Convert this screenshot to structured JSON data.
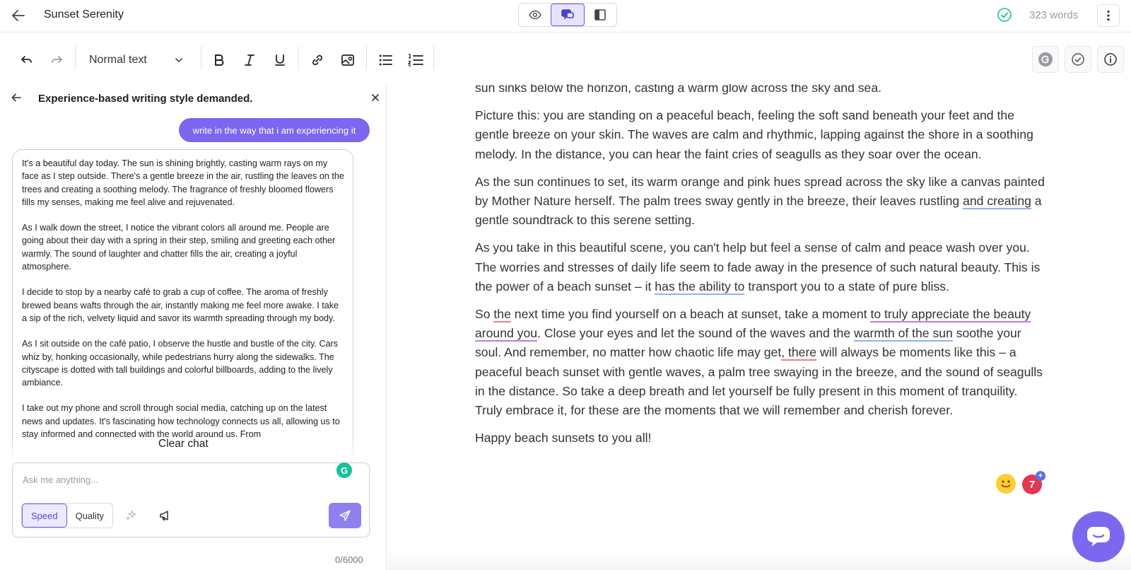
{
  "header": {
    "doc_title": "Sunset Serenity",
    "word_count": "323 words"
  },
  "toolbar": {
    "text_style": "Normal text"
  },
  "chat": {
    "title": "Experience-based writing style demanded.",
    "user_message": "write in the way that i am experiencing it",
    "assistant_paragraphs": [
      "It's a beautiful day today. The sun is shining brightly, casting warm rays on my face as I step outside. There's a gentle breeze in the air, rustling the leaves on the trees and creating a soothing melody. The fragrance of freshly bloomed flowers fills my senses, making me feel alive and rejuvenated.",
      "As I walk down the street, I notice the vibrant colors all around me. People are going about their day with a spring in their step, smiling and greeting each other warmly. The sound of laughter and chatter fills the air, creating a joyful atmosphere.",
      "I decide to stop by a nearby café to grab a cup of coffee. The aroma of freshly brewed beans wafts through the air, instantly making me feel more awake. I take a sip of the rich, velvety liquid and savor its warmth spreading through my body.",
      "As I sit outside on the café patio, I observe the hustle and bustle of the city. Cars whiz by, honking occasionally, while pedestrians hurry along the sidewalks. The cityscape is dotted with tall buildings and colorful billboards, adding to the lively ambiance.",
      "I take out my phone and scroll through social media, catching up on the latest news and updates. It's fascinating how technology connects us all, allowing us to stay informed and connected with the world around us. From"
    ],
    "clear_chat_label": "Clear chat",
    "input_placeholder": "Ask me anything...",
    "mode_speed": "Speed",
    "mode_quality": "Quality",
    "char_count": "0/6000",
    "grammarly_badge": "G"
  },
  "editor": {
    "p1": "sun sinks below the horizon, casting a warm glow across the sky and sea.",
    "p2": "Picture this: you are standing on a peaceful beach, feeling the soft sand beneath your feet and the gentle breeze on your skin. The waves are calm and rhythmic, lapping against the shore in a soothing melody. In the distance, you can hear the faint cries of seagulls as they soar over the ocean.",
    "p3_a": "As the sun continues to set, its warm orange and pink hues spread across the sky like a canvas painted by Mother Nature herself. The palm trees sway gently in the breeze, their leaves rustling ",
    "p3_u1": "and creating",
    "p3_b": " a gentle soundtrack to this serene setting.",
    "p4_a": "As you take in this beautiful scene, you can't help but feel a sense of calm and peace wash over you. The worries and stresses of daily life seem to fade away in the presence of such natural beauty. This is the power of a beach sunset – it ",
    "p4_u1": "has the ability to",
    "p4_b": " transport you to a state of pure bliss.",
    "p5_a": "So ",
    "p5_u1": "the",
    "p5_b": " next time you find yourself on a beach at sunset, take a moment ",
    "p5_u2": "to truly appreciate the beauty around you",
    "p5_c": ". Close your eyes and let the sound of the waves and the ",
    "p5_u3": "warmth of the sun",
    "p5_d": " soothe your soul. And remember, no matter how chaotic life may get",
    "p5_u4": ", there",
    "p5_e": " will always be moments like this – a peaceful beach sunset with gentle waves, a palm tree swaying in the breeze, and the sound of seagulls in the distance.  So take a deep breath and let yourself be fully present in this moment of tranquility.  Truly embrace it, for these are the moments that we will remember and cherish forever.",
    "p6": "Happy beach sunsets to you all!"
  },
  "assistant_badges": {
    "issue_count": "7",
    "plus": "+"
  },
  "colors": {
    "accent": "#7b68ee",
    "success": "#15c39a",
    "alert": "#e5364f"
  },
  "icons": [
    "arrow-left-icon",
    "eye-icon",
    "chat-bubbles-icon",
    "sidebar-panel-icon",
    "check-circle-icon",
    "kebab-menu-icon",
    "undo-icon",
    "redo-icon",
    "chevron-down-icon",
    "bold-icon",
    "italic-icon",
    "underline-icon",
    "link-icon",
    "image-icon",
    "bullet-list-icon",
    "numbered-list-icon",
    "grammarly-icon",
    "info-icon",
    "close-icon",
    "sparkle-icon",
    "megaphone-icon",
    "send-icon",
    "smiley-icon",
    "chat-icon"
  ]
}
